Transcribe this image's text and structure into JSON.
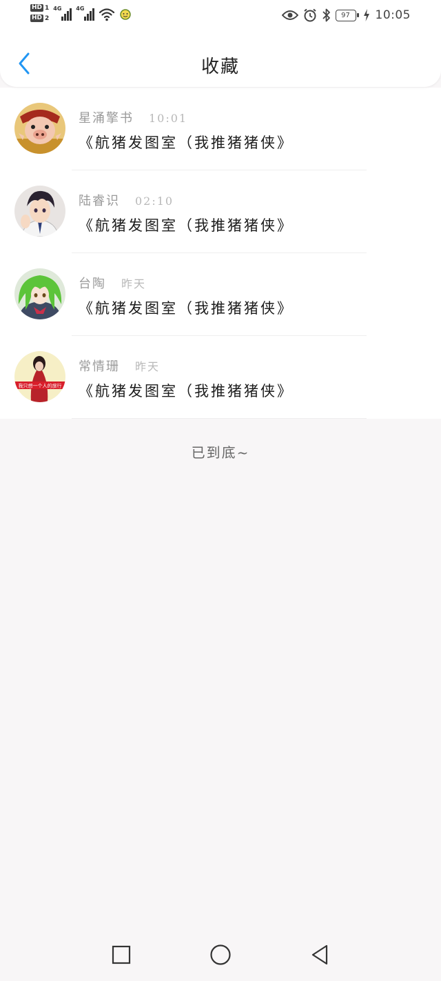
{
  "status_bar": {
    "sim1_label": "HD",
    "sim1_num": "1",
    "sim2_label": "HD",
    "sim2_num": "2",
    "net1": "4G",
    "net2": "4G",
    "battery": "97",
    "time": "10:05",
    "icons": [
      "signal-icon",
      "wifi-icon",
      "notification-icon",
      "eye-icon",
      "alarm-icon",
      "bluetooth-icon",
      "battery-icon",
      "charging-icon"
    ]
  },
  "header": {
    "back_icon": "chevron-left-icon",
    "title": "收藏",
    "accent_color": "#2196F3"
  },
  "items": [
    {
      "name": "星涌擎书",
      "time": "10:01",
      "title": "《航猪发图室（我推猪猪侠》",
      "avatar": "pig-character-avatar"
    },
    {
      "name": "陆睿识",
      "time": "02:10",
      "title": "《航猪发图室（我推猪猪侠》",
      "avatar": "anime-boy-avatar"
    },
    {
      "name": "台陶",
      "time": "昨天",
      "title": "《航猪发图室（我推猪猪侠》",
      "avatar": "green-hair-girl-avatar"
    },
    {
      "name": "常情珊",
      "time": "昨天",
      "title": "《航猪发图室（我推猪猪侠》",
      "avatar": "girl-red-scarf-avatar",
      "avatar_caption": "我只想一个人的旅行"
    }
  ],
  "footer_text": "已到底~",
  "nav": {
    "recents": "square-icon",
    "home": "circle-icon",
    "back": "triangle-back-icon"
  }
}
